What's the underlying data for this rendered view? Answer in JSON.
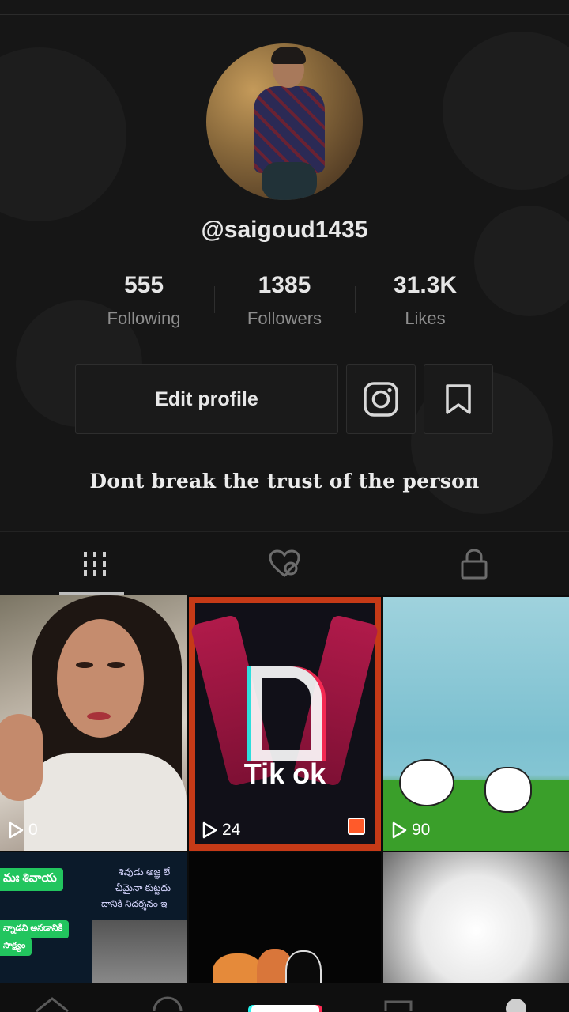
{
  "profile": {
    "username": "@saigoud1435",
    "bio": "Dont break the trust of the person"
  },
  "stats": {
    "following": {
      "value": "555",
      "label": "Following"
    },
    "followers": {
      "value": "1385",
      "label": "Followers"
    },
    "likes": {
      "value": "31.3K",
      "label": "Likes"
    }
  },
  "actions": {
    "edit_profile": "Edit profile",
    "instagram_icon": "instagram-icon",
    "bookmark_icon": "bookmark-icon"
  },
  "tabs": [
    {
      "icon": "grid-icon",
      "selected": true
    },
    {
      "icon": "liked-hidden-icon",
      "selected": false
    },
    {
      "icon": "lock-icon",
      "selected": false
    }
  ],
  "videos": [
    {
      "views": "0"
    },
    {
      "views": "24",
      "overlay_text": "Tik ok"
    },
    {
      "views": "90"
    },
    {
      "text_1": "మః శివాయ",
      "text_2": "శివుడు అజ్ఞ లే",
      "text_3": "చీమైనా కుట్టదు",
      "text_4": "దానికి నిదర్శనం ఇ",
      "text_5": "న్నాడని అనడానికి",
      "text_6": "సాక్ష్యం"
    },
    {},
    {}
  ],
  "colors": {
    "background": "#161616",
    "accent_cyan": "#25f4ee",
    "accent_red": "#fe2c55"
  }
}
